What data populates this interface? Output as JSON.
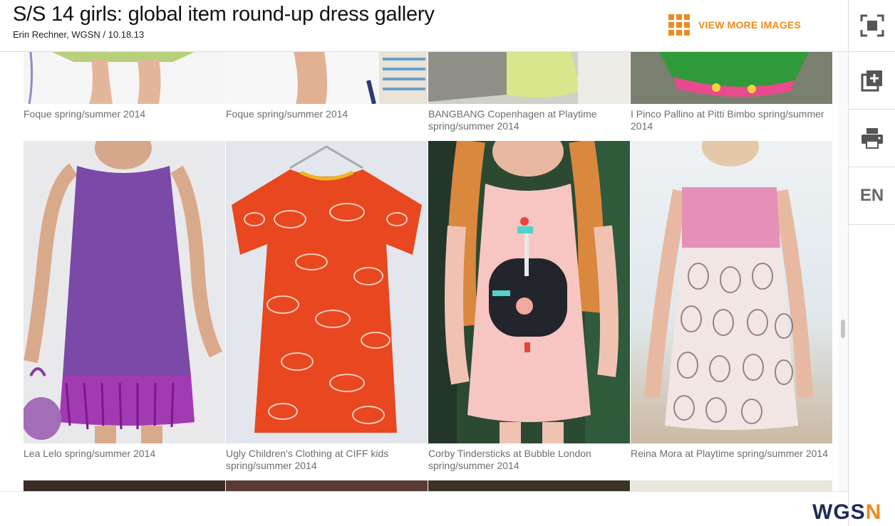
{
  "header": {
    "title": "S/S 14 girls: global item round-up dress gallery",
    "byline": "Erin Rechner, WGSN / 10.18.13",
    "view_more_label": "VIEW MORE IMAGES",
    "view_more_icon": "grid-icon"
  },
  "rail": {
    "fullscreen_icon": "fullscreen-icon",
    "add_icon": "add-to-board-icon",
    "print_icon": "print-icon",
    "language_label": "EN"
  },
  "gallery": {
    "row1": [
      {
        "caption": "Foque spring/summer 2014"
      },
      {
        "caption": "Foque spring/summer 2014"
      },
      {
        "caption": "BANGBANG Copenhagen at Playtime spring/summer 2014"
      },
      {
        "caption": "I Pinco Pallino at Pitti Bimbo spring/summer 2014"
      }
    ],
    "row2": [
      {
        "caption": "Lea Lelo spring/summer 2014"
      },
      {
        "caption": "Ugly Children's Clothing at CIFF kids spring/summer 2014"
      },
      {
        "caption": "Corby Tindersticks at Bubble London spring/summer 2014"
      },
      {
        "caption": "Reina Mora at Playtime spring/summer 2014"
      }
    ]
  },
  "footer": {
    "logo_part1": "WGS",
    "logo_part2": "N"
  },
  "colors": {
    "accent": "#f08a1d",
    "logo_dark": "#1d2b56"
  }
}
